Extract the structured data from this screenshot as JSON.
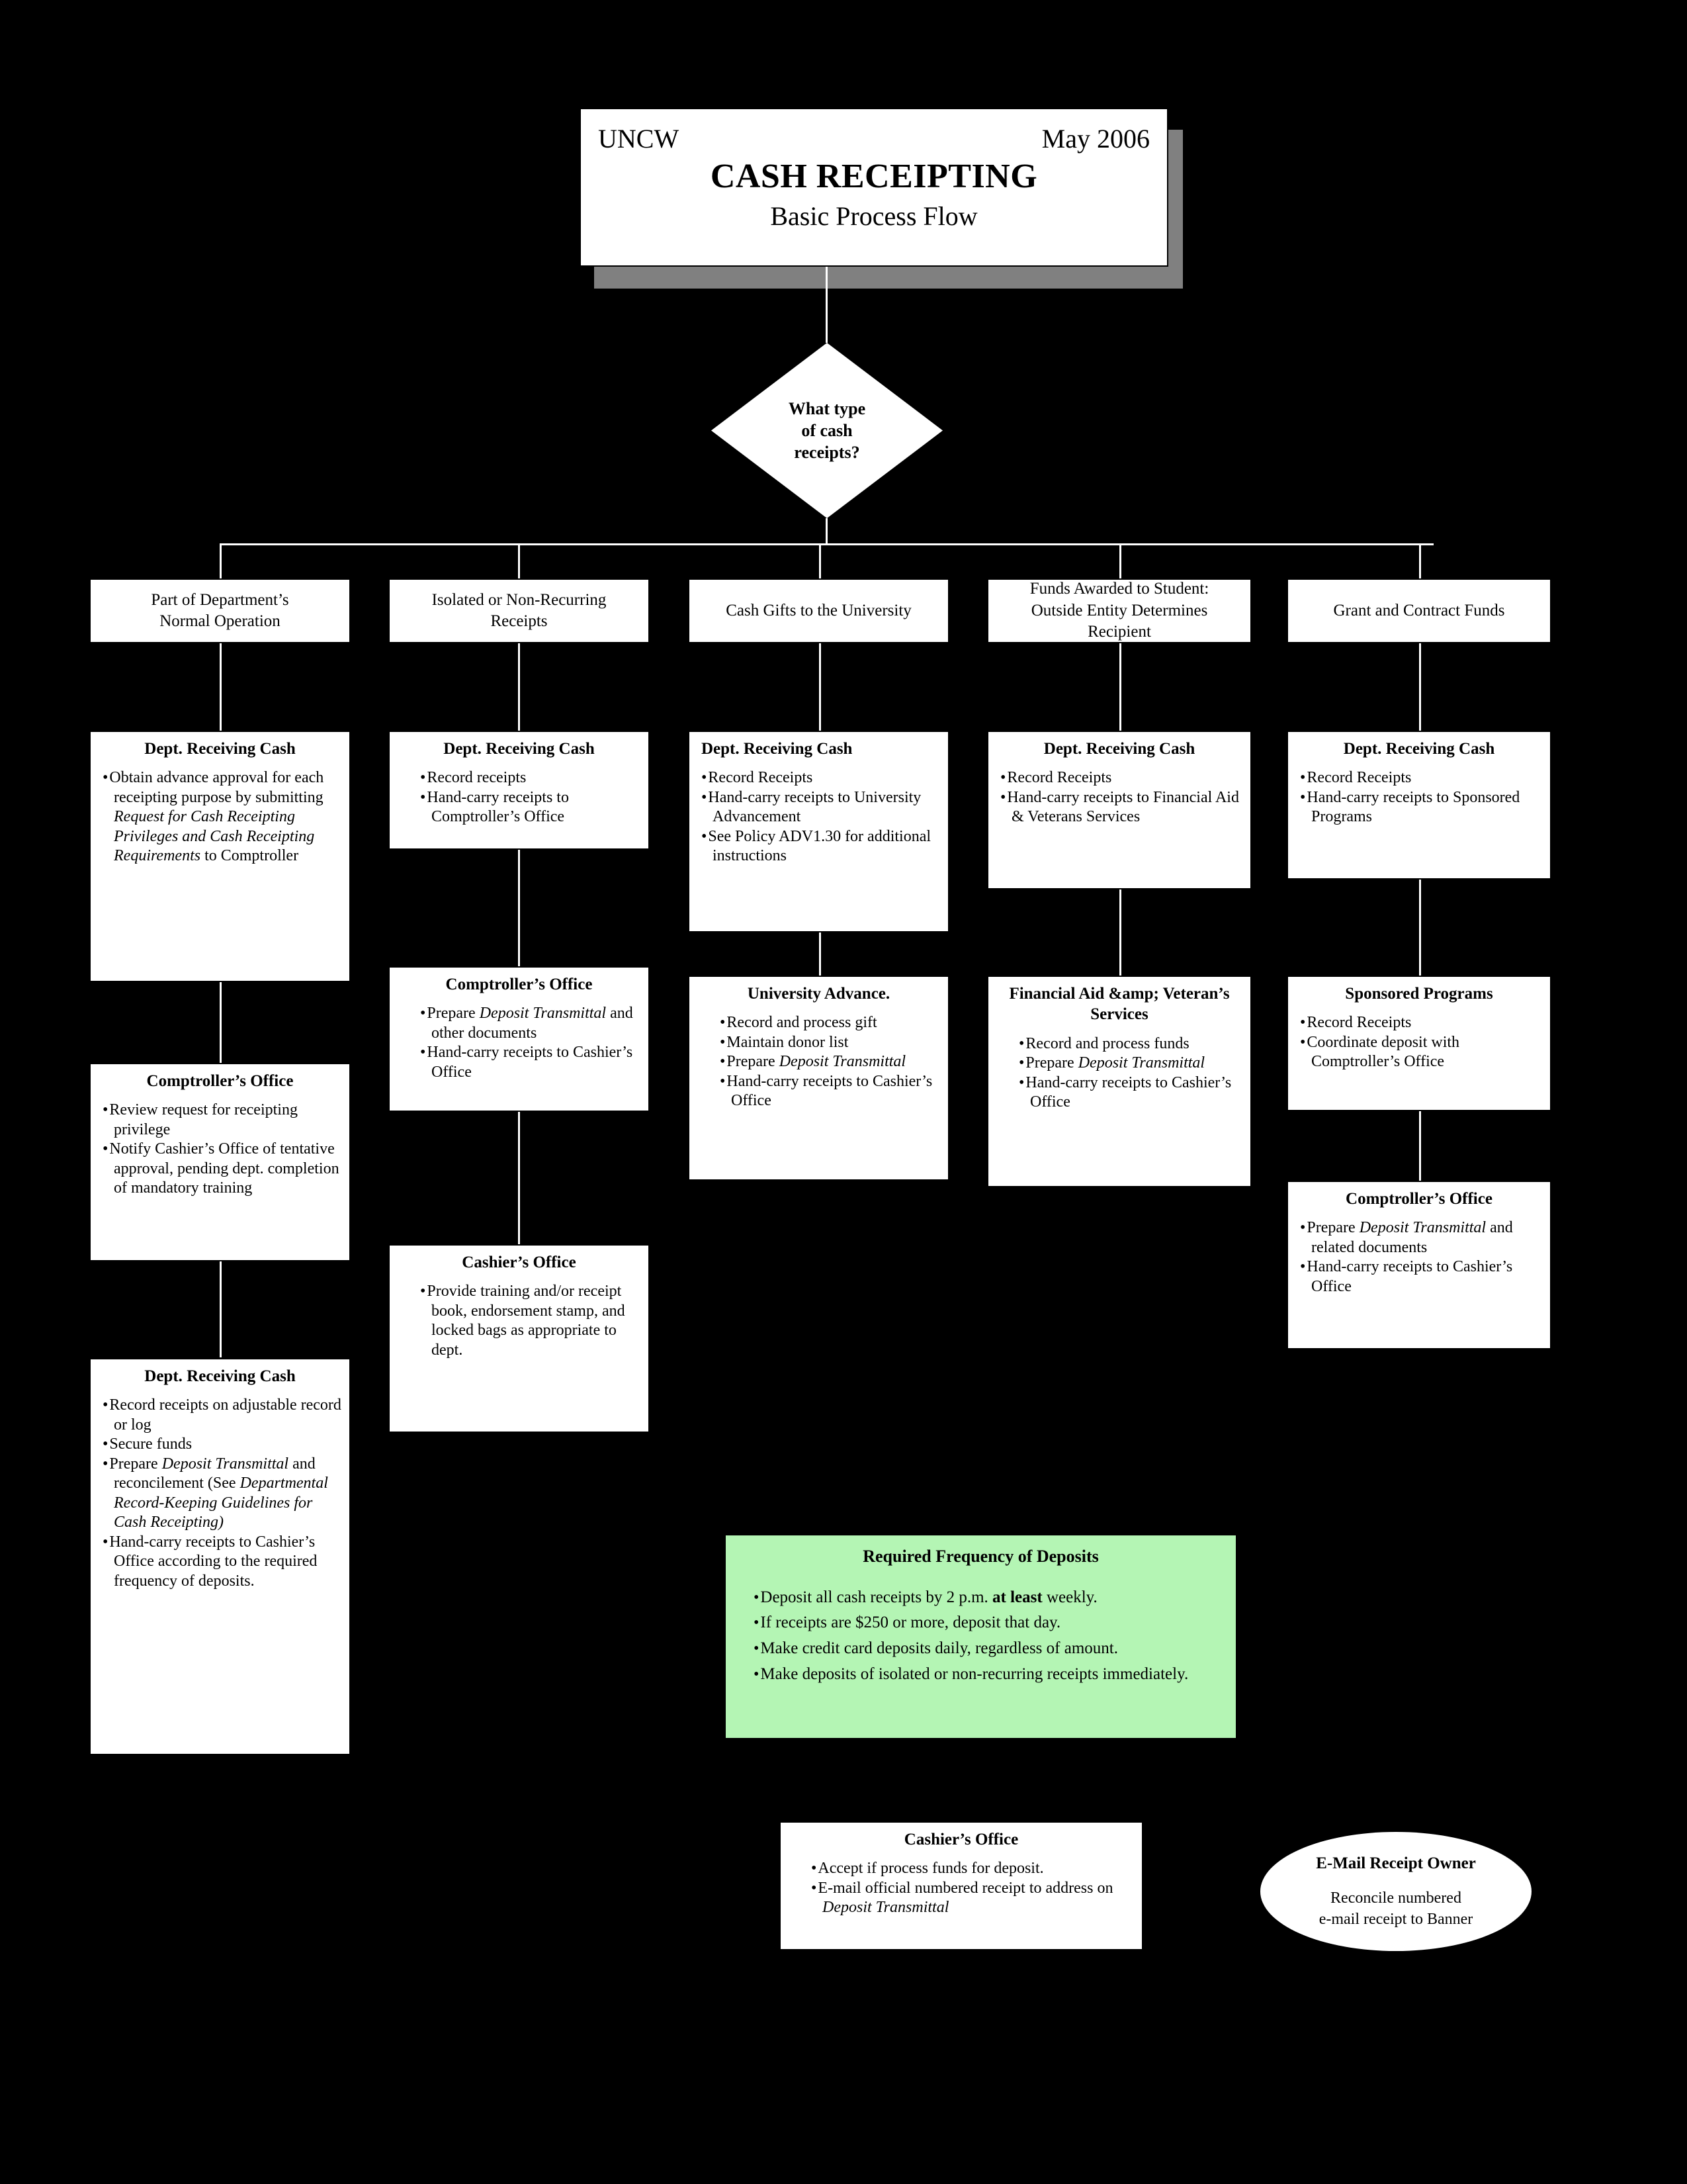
{
  "title": {
    "org": "UNCW",
    "date": "May 2006",
    "main": "CASH RECEIPTING",
    "subtitle": "Basic Process Flow"
  },
  "decision": {
    "line1": "What type",
    "line2": "of cash",
    "line3": "receipts?"
  },
  "categories": [
    {
      "line1": "Part of Department’s",
      "line2": "Normal Operation"
    },
    {
      "line1": "Isolated or Non-Recurring",
      "line2": "Receipts"
    },
    {
      "line1": "Cash Gifts to the University",
      "line2": ""
    },
    {
      "line1": "Funds Awarded to Student:",
      "line2": "Outside Entity Determines",
      "line3": "Recipient"
    },
    {
      "line1": "Grant and Contract Funds",
      "line2": ""
    }
  ],
  "col1": {
    "box1": {
      "heading": "Dept. Receiving Cash",
      "items": [
        "Obtain advance approval for each receipting purpose by submitting <i>Request for Cash Receipting Privileges and Cash Receipting Requirements</i> to Comptroller"
      ]
    },
    "box2": {
      "heading": "Comptroller’s Office",
      "items": [
        "Review request for receipting privilege",
        "Notify Cashier’s Office of tentative approval, pending dept. completion of mandatory training"
      ]
    },
    "box3": {
      "heading": "Dept. Receiving Cash",
      "items": [
        "Record receipts on adjustable record or log",
        "Secure funds",
        "Prepare <i>Deposit Transmittal</i> and reconcilement (See <i>Departmental Record-Keeping Guidelines for Cash Receipting)</i>",
        "Hand-carry receipts to Cashier’s Office according to the required frequency of deposits."
      ]
    }
  },
  "col2": {
    "box1": {
      "heading": "Dept. Receiving Cash",
      "items": [
        "Record receipts",
        "Hand-carry receipts to Comptroller’s Office"
      ]
    },
    "box2": {
      "heading": "Comptroller’s Office",
      "items": [
        "Prepare <i>Deposit Transmittal</i> and other documents",
        "Hand-carry receipts to Cashier’s Office"
      ]
    },
    "box3": {
      "heading": "Cashier’s Office",
      "items": [
        "Provide training and/or receipt book, endorsement stamp, and locked bags as appropriate to dept."
      ]
    }
  },
  "col3": {
    "box1": {
      "heading": "Dept. Receiving Cash",
      "items": [
        "Record Receipts",
        "Hand-carry receipts to University Advancement",
        "See Policy ADV1.30 for additional instructions"
      ]
    },
    "box2": {
      "heading": "University Advance.",
      "items": [
        "Record and process gift",
        "Maintain donor list",
        "Prepare <i>Deposit Transmittal</i>",
        "Hand-carry receipts to Cashier’s Office"
      ]
    }
  },
  "col4": {
    "box1": {
      "heading": "Dept. Receiving Cash",
      "items": [
        "Record Receipts",
        "Hand-carry receipts to Financial Aid &amp; Veterans Services"
      ]
    },
    "box2": {
      "heading": "Financial Aid &amp; Veteran’s Services",
      "items": [
        "Record and process funds",
        "Prepare <i>Deposit Transmittal</i>",
        "Hand-carry receipts to Cashier’s Office"
      ]
    }
  },
  "col5": {
    "box1": {
      "heading": "Dept. Receiving Cash",
      "items": [
        "Record Receipts",
        "Hand-carry receipts to Sponsored Programs"
      ]
    },
    "box2": {
      "heading": "Sponsored Programs",
      "items": [
        "Record Receipts",
        "Coordinate deposit with Comptroller’s Office"
      ]
    },
    "box3": {
      "heading": "Comptroller’s Office",
      "items": [
        "Prepare <i>Deposit Transmittal</i> and related documents",
        "Hand-carry receipts to Cashier’s Office"
      ]
    }
  },
  "frequency": {
    "heading": "Required Frequency of Deposits",
    "items": [
      "Deposit all cash receipts by 2 p.m. <b>at least</b> weekly.",
      "If receipts are $250 or more, deposit that day.",
      "Make credit card deposits daily, regardless of amount.",
      "Make deposits of isolated or non-recurring receipts immediately."
    ]
  },
  "cashier_final": {
    "heading": "Cashier’s Office",
    "items": [
      "Accept if process funds for deposit.",
      "E-mail official numbered receipt to address on <i>Deposit Transmittal</i>"
    ]
  },
  "email_owner": {
    "heading": "E-Mail Receipt Owner",
    "line1": "Reconcile numbered",
    "line2": "e-mail receipt to Banner"
  },
  "colors": {
    "background": "#000000",
    "node_fill": "#ffffff",
    "green_fill": "#b4f5b4",
    "shadow": "#808080"
  }
}
